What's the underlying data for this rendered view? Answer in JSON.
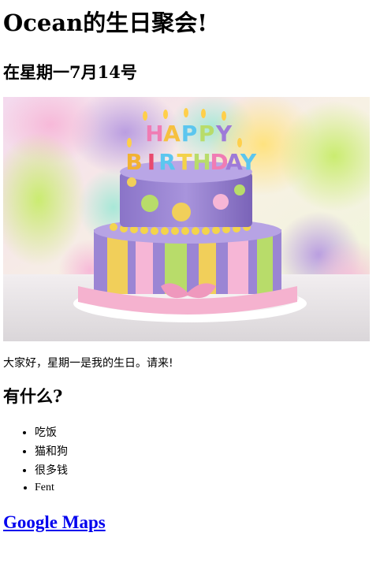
{
  "page": {
    "title": "Ocean的生日聚会!",
    "date_heading": "在星期一7月14号",
    "image": {
      "alt": "生日蛋糕",
      "banner_text": "HAPPY BIRTHDAY"
    },
    "intro": "大家好，星期一是我的生日。请来!",
    "section_heading": "有什么?",
    "items": [
      "吃饭",
      "猫和狗",
      "很多钱",
      "Fent"
    ],
    "map_link": "Google Maps"
  },
  "colors": {
    "link": "#0000ee",
    "text": "#000000",
    "background": "#ffffff"
  }
}
